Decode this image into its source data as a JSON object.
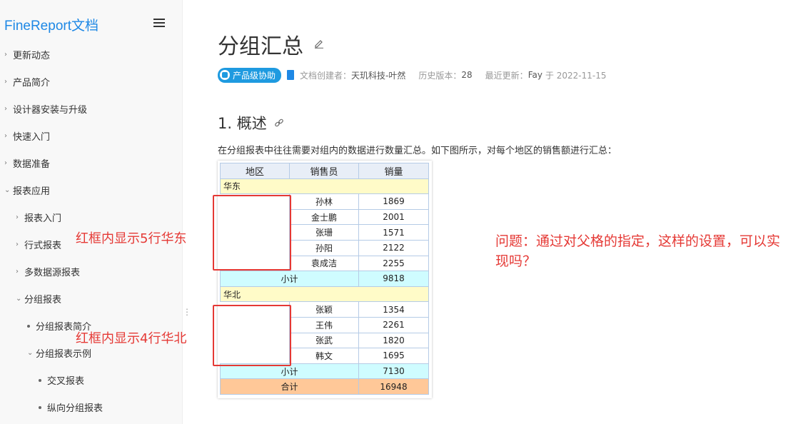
{
  "sidebar": {
    "brand": "FineReport文档",
    "items": [
      {
        "label": "更新动态"
      },
      {
        "label": "产品简介"
      },
      {
        "label": "设计器安装与升级"
      },
      {
        "label": "快速入门"
      },
      {
        "label": "数据准备"
      },
      {
        "label": "报表应用"
      },
      {
        "label": "报表入门"
      },
      {
        "label": "行式报表"
      },
      {
        "label": "多数据源报表"
      },
      {
        "label": "分组报表"
      },
      {
        "label": "分组报表简介"
      },
      {
        "label": "分组报表示例"
      },
      {
        "label": "交叉报表"
      },
      {
        "label": "纵向分组报表"
      }
    ]
  },
  "page": {
    "title": "分组汇总",
    "badge": "产品级协助",
    "creator_label": "文档创建者：",
    "creator": "天玑科技-叶然",
    "history_label": "历史版本：",
    "history": "28",
    "updated_label": "最近更新：",
    "updated_by": "Fay",
    "updated_on": "于 2022-11-15",
    "section_title": "1. 概述",
    "description": "在分组报表中往往需要对组内的数据进行数量汇总。如下图所示，对每个地区的销售额进行汇总："
  },
  "table": {
    "headers": [
      "地区",
      "销售员",
      "销量"
    ],
    "group1": {
      "name": "华东",
      "rows": [
        [
          "孙林",
          "1869"
        ],
        [
          "金士鹏",
          "2001"
        ],
        [
          "张珊",
          "1571"
        ],
        [
          "孙阳",
          "2122"
        ],
        [
          "袁成洁",
          "2255"
        ]
      ],
      "subtotal_label": "小计",
      "subtotal": "9818"
    },
    "group2": {
      "name": "华北",
      "rows": [
        [
          "张颖",
          "1354"
        ],
        [
          "王伟",
          "2261"
        ],
        [
          "张武",
          "1820"
        ],
        [
          "韩文",
          "1695"
        ]
      ],
      "subtotal_label": "小计",
      "subtotal": "7130"
    },
    "total_label": "合计",
    "total": "16948"
  },
  "annotations": {
    "note1": "红框内显示5行华东",
    "note2": "红框内显示4行华北",
    "question": "问题：通过对父格的指定，这样的设置，可以实现吗？"
  },
  "colors": {
    "accent": "#1e88e5",
    "annotation": "#e53935"
  }
}
